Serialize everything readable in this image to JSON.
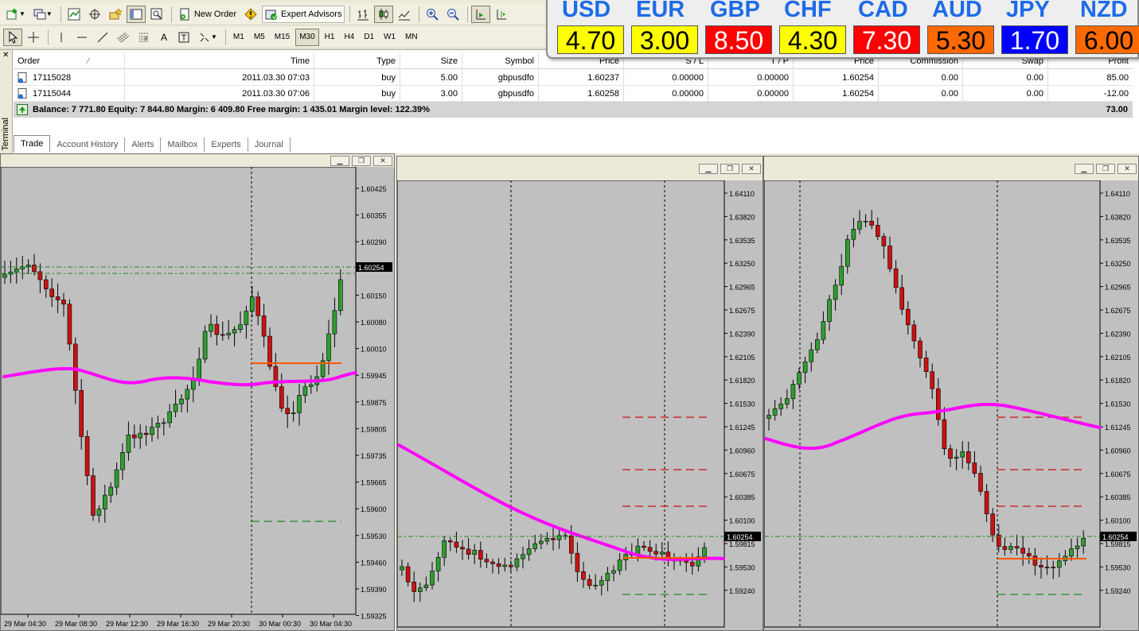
{
  "toolbar1": {
    "new_order_label": "New Order",
    "expert_advisors_label": "Expert Advisors"
  },
  "timeframes": [
    "M1",
    "M5",
    "M15",
    "M30",
    "H1",
    "H4",
    "D1",
    "W1",
    "MN"
  ],
  "active_timeframe": "M30",
  "strength": [
    {
      "label": "USD",
      "value": "4.70",
      "bg": "#ffff00",
      "fg": "#000000"
    },
    {
      "label": "EUR",
      "value": "3.00",
      "bg": "#ffff00",
      "fg": "#000000"
    },
    {
      "label": "GBP",
      "value": "8.50",
      "bg": "#ff0000",
      "fg": "#ffffff"
    },
    {
      "label": "CHF",
      "value": "4.30",
      "bg": "#ffff00",
      "fg": "#000000"
    },
    {
      "label": "CAD",
      "value": "7.30",
      "bg": "#ff0000",
      "fg": "#ffffff"
    },
    {
      "label": "AUD",
      "value": "5.30",
      "bg": "#ff6a00",
      "fg": "#000000"
    },
    {
      "label": "JPY",
      "value": "1.70",
      "bg": "#0000ff",
      "fg": "#ffffff"
    },
    {
      "label": "NZD",
      "value": "6.00",
      "bg": "#ff6a00",
      "fg": "#000000"
    }
  ],
  "terminal": {
    "side_label": "Terminal",
    "headers": {
      "order": "Order",
      "time": "Time",
      "type": "Type",
      "size": "Size",
      "symbol": "Symbol",
      "price": "Price",
      "sl": "S / L",
      "tp": "T / P",
      "price2": "Price",
      "commission": "Commission",
      "swap": "Swap",
      "profit": "Profit"
    },
    "rows": [
      {
        "order": "17115028",
        "time": "2011.03.30 07:03",
        "type": "buy",
        "size": "5.00",
        "symbol": "gbpusdfo",
        "price": "1.60237",
        "sl": "0.00000",
        "tp": "0.00000",
        "price2": "1.60254",
        "commission": "0.00",
        "swap": "0.00",
        "profit": "85.00"
      },
      {
        "order": "17115044",
        "time": "2011.03.30 07:06",
        "type": "buy",
        "size": "3.00",
        "symbol": "gbpusdfo",
        "price": "1.60258",
        "sl": "0.00000",
        "tp": "0.00000",
        "price2": "1.60254",
        "commission": "0.00",
        "swap": "0.00",
        "profit": "-12.00"
      }
    ],
    "balance_text": "Balance: 7 771.80  Equity: 7 844.80  Margin: 6 409.80  Free margin: 1 435.01  Margin level: 122.39%",
    "total_profit": "73.00",
    "tabs": [
      "Trade",
      "Account History",
      "Alerts",
      "Mailbox",
      "Experts",
      "Journal"
    ],
    "active_tab": "Trade"
  },
  "colors": {
    "bull": "#2e9e2e",
    "bear": "#cc1111",
    "ma": "#ff00ff",
    "entry": "#ff5500",
    "chart_bg": "#c0c0c0"
  },
  "charts": [
    {
      "ticks": [
        "1.60425",
        "1.60355",
        "1.60290",
        "1.60220",
        "1.60150",
        "1.60080",
        "1.60010",
        "1.59945",
        "1.59875",
        "1.59805",
        "1.59735",
        "1.59665",
        "1.59600",
        "1.59530",
        "1.59460",
        "1.59390",
        "1.59325"
      ],
      "price_label": "1.60254",
      "time_labels": [
        "29 Mar 04:30",
        "29 Mar 08:30",
        "29 Mar 12:30",
        "29 Mar 16:30",
        "29 Mar 20:30",
        "30 Mar 00:30",
        "30 Mar 04:30"
      ]
    },
    {
      "ticks": [
        "1.64110",
        "1.63820",
        "1.63535",
        "1.63250",
        "1.62965",
        "1.62675",
        "1.62390",
        "1.62105",
        "1.61820",
        "1.61530",
        "1.61245",
        "1.60960",
        "1.60675",
        "1.60385",
        "1.60100",
        "1.59815",
        "1.59530",
        "1.59240"
      ],
      "price_label": "1.60254",
      "time_labels": []
    },
    {
      "ticks": [
        "1.64110",
        "1.63820",
        "1.63535",
        "1.63250",
        "1.62965",
        "1.62675",
        "1.62390",
        "1.62105",
        "1.61820",
        "1.61530",
        "1.61245",
        "1.60960",
        "1.60675",
        "1.60385",
        "1.60100",
        "1.59815",
        "1.59530",
        "1.59240"
      ],
      "price_label": "1.60254",
      "time_labels": []
    }
  ]
}
